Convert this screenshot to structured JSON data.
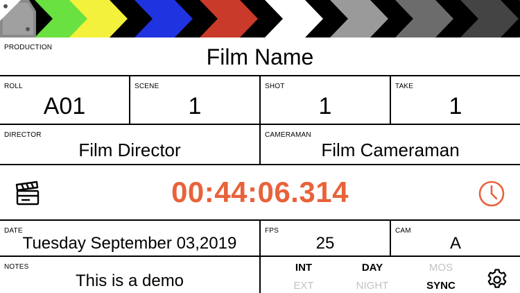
{
  "clapper": {
    "stripe_colors": [
      "#69e140",
      "#f4f13c",
      "#1f33e0",
      "#c93a2a",
      "#ffffff",
      "#9a9a9a",
      "#6c6c6c",
      "#444444",
      "#2a2a2a"
    ]
  },
  "production": {
    "label": "PRODUCTION",
    "value": "Film Name"
  },
  "roll": {
    "label": "ROLL",
    "value": "A01"
  },
  "scene": {
    "label": "SCENE",
    "value": "1"
  },
  "shot": {
    "label": "SHOT",
    "value": "1"
  },
  "take": {
    "label": "TAKE",
    "value": "1"
  },
  "director": {
    "label": "DIRECTOR",
    "value": "Film Director"
  },
  "cameraman": {
    "label": "CAMERAMAN",
    "value": "Film Cameraman"
  },
  "timecode": {
    "value": "00:44:06.314",
    "color": "#e8623a",
    "left_icon": "clapperboard-icon",
    "right_icon": "clock-icon"
  },
  "date": {
    "label": "DATE",
    "value": "Tuesday September 03,2019"
  },
  "fps": {
    "label": "FPS",
    "value": "25"
  },
  "cam": {
    "label": "CAM",
    "value": "A"
  },
  "notes": {
    "label": "NOTES",
    "value": "This is a demo"
  },
  "toggles": {
    "int": {
      "label": "INT",
      "active": true
    },
    "ext": {
      "label": "EXT",
      "active": false
    },
    "day": {
      "label": "DAY",
      "active": true
    },
    "night": {
      "label": "NIGHT",
      "active": false
    },
    "mos": {
      "label": "MOS",
      "active": false
    },
    "sync": {
      "label": "SYNC",
      "active": true
    }
  },
  "settings_icon": "gear-icon"
}
